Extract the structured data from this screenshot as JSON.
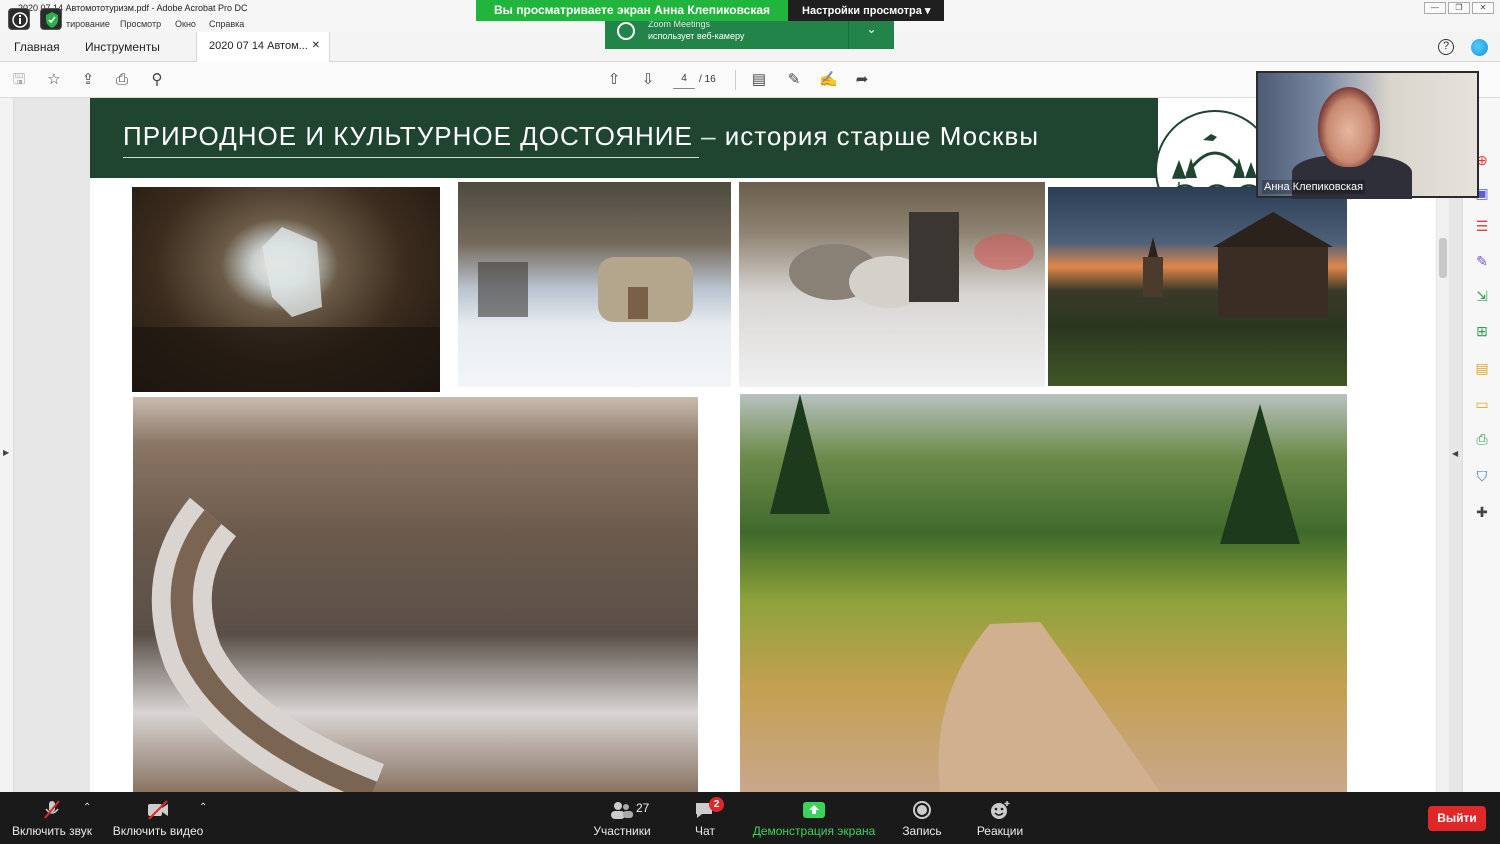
{
  "window": {
    "title": "2020 07 14 Автомототуризм.pdf - Adobe Acrobat Pro DC",
    "buttons": [
      "—",
      "❐",
      "✕"
    ]
  },
  "menu": {
    "items": [
      "тирование",
      "Просмотр",
      "Окно",
      "Справка"
    ]
  },
  "zoom_share": {
    "banner": "Вы просматриваете экран Анна Клепиковская",
    "view_settings": "Настройки просмотра ▾",
    "cam_app": "Zoom Meetings",
    "cam_text": "использует веб-камеру",
    "cam_chevron": "⌄"
  },
  "acrobat": {
    "tab_home": "Главная",
    "tab_tools": "Инструменты",
    "tab_doc": "2020 07 14 Автом...",
    "tab_close": "✕",
    "help": "?",
    "page_current": "4",
    "page_total": "/ 16"
  },
  "toolbar_icons": {
    "save": "🖫",
    "star": "☆",
    "upload": "⇪",
    "print": "⎙",
    "zoom": "⚲",
    "prev": "⇧",
    "next": "⇩",
    "comment": "▤",
    "pen": "✎",
    "sign": "✍",
    "share": "➦"
  },
  "slide": {
    "title_main": "ПРИРОДНОЕ И КУЛЬТУРНОЕ ДОСТОЯНИЕ",
    "title_dash": " – ",
    "title_sub": "история старше Москвы"
  },
  "video": {
    "participant_name": "Анна Клепиковская"
  },
  "zoombar": {
    "audio": "Включить звук",
    "video": "Включить видео",
    "participants": "Участники",
    "participants_count": "27",
    "chat": "Чат",
    "chat_badge": "2",
    "share": "Демонстрация экрана",
    "record": "Запись",
    "reactions": "Реакции",
    "leave": "Выйти",
    "caret": "⌃"
  },
  "colors": {
    "banner_green": "#22b53d",
    "slide_green": "#1f4530",
    "share_green": "#3bd35b",
    "leave_red": "#e02828"
  }
}
